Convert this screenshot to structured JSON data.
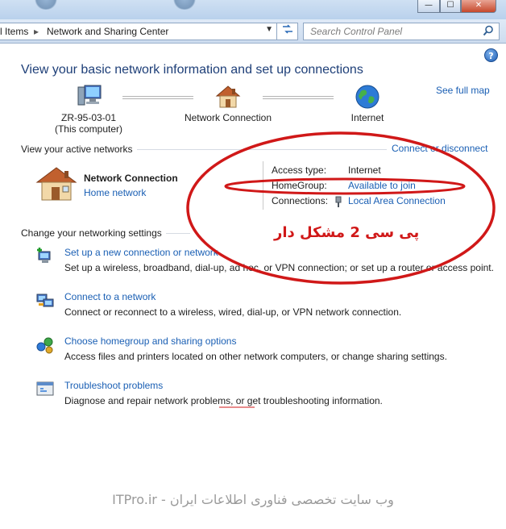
{
  "window": {
    "minimize": "—",
    "maximize": "☐",
    "close": "✕"
  },
  "address": {
    "crumb1": "l Items",
    "sep": "▸",
    "crumb2": "Network and Sharing Center"
  },
  "search": {
    "placeholder": "Search Control Panel"
  },
  "help_label": "?",
  "page_title": "View your basic network information and set up connections",
  "see_full_map": "See full map",
  "map": {
    "computer_name": "ZR-95-03-01",
    "computer_sub": "(This computer)",
    "network": "Network Connection",
    "internet": "Internet"
  },
  "active": {
    "heading": "View your active networks",
    "connect_link": "Connect or disconnect",
    "network_name": "Network Connection",
    "network_type": "Home network",
    "access_type_label": "Access type:",
    "access_type_value": "Internet",
    "homegroup_label": "HomeGroup:",
    "homegroup_value": "Available to join",
    "connections_label": "Connections:",
    "connections_value": "Local Area Connection"
  },
  "settings": {
    "heading": "Change your networking settings",
    "tasks": [
      {
        "title": "Set up a new connection or network",
        "desc": "Set up a wireless, broadband, dial-up, ad hoc, or VPN connection; or set up a router or access point."
      },
      {
        "title": "Connect to a network",
        "desc": "Connect or reconnect to a wireless, wired, dial-up, or VPN network connection."
      },
      {
        "title": "Choose homegroup and sharing options",
        "desc": "Access files and printers located on other network computers, or change sharing settings."
      },
      {
        "title": "Troubleshoot problems",
        "desc": "Diagnose and repair network problems, or get troubleshooting information."
      }
    ]
  },
  "annotation": "پی سی 2 مشکل دار",
  "watermark": "ITPro.ir - وب سایت تخصصی فناوری اطلاعات ایران",
  "colors": {
    "link": "#1a5fb4",
    "title": "#1e3f78",
    "annotation": "#d01818"
  }
}
